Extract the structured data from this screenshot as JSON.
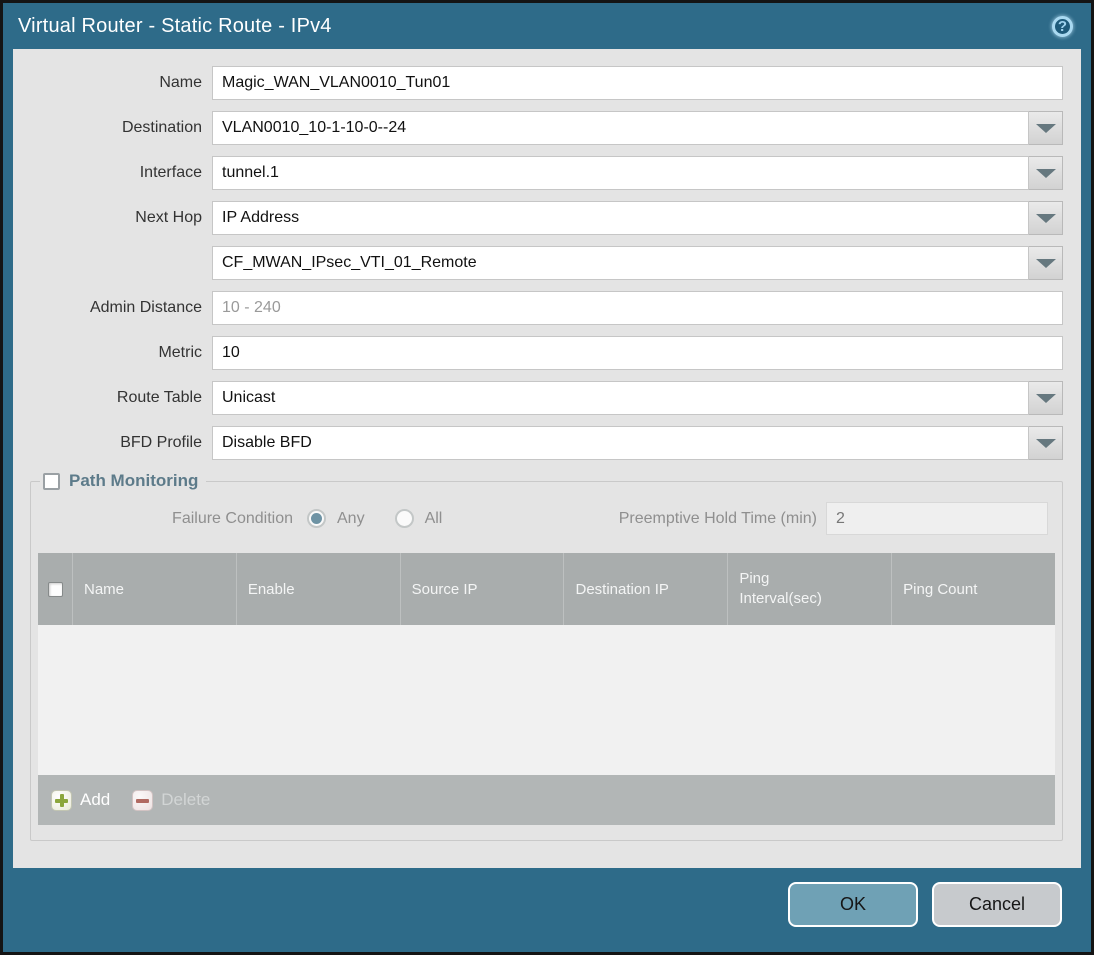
{
  "title": "Virtual Router - Static Route - IPv4",
  "icons": {
    "help_glyph": "?"
  },
  "colors": {
    "chrome_teal": "#2e6b89",
    "panel_gray": "#e4e4e4",
    "accent_legend": "#5d7b8a",
    "table_header_gray": "#a9adad",
    "ok_button": "#6fa1b5",
    "cancel_button": "#c7cacd",
    "add_icon_green": "#8ba63c",
    "delete_icon_red": "#b16a62"
  },
  "form": {
    "name": {
      "label": "Name",
      "value": "Magic_WAN_VLAN0010_Tun01"
    },
    "destination": {
      "label": "Destination",
      "value": "VLAN0010_10-1-10-0--24"
    },
    "interface": {
      "label": "Interface",
      "value": "tunnel.1"
    },
    "next_hop": {
      "label": "Next Hop",
      "value": "IP Address"
    },
    "next_hop_address": {
      "value": "CF_MWAN_IPsec_VTI_01_Remote"
    },
    "admin_distance": {
      "label": "Admin Distance",
      "value": "",
      "placeholder": "10 - 240"
    },
    "metric": {
      "label": "Metric",
      "value": "10"
    },
    "route_table": {
      "label": "Route Table",
      "value": "Unicast"
    },
    "bfd_profile": {
      "label": "BFD Profile",
      "value": "Disable BFD"
    }
  },
  "path_monitoring": {
    "legend": "Path Monitoring",
    "checked": false,
    "failure_condition": {
      "label": "Failure Condition",
      "options": [
        {
          "label": "Any",
          "selected": true
        },
        {
          "label": "All",
          "selected": false
        }
      ]
    },
    "preemptive_hold_time": {
      "label": "Preemptive Hold Time (min)",
      "value": "2"
    },
    "table": {
      "columns": [
        "Name",
        "Enable",
        "Source IP",
        "Destination IP",
        "Ping Interval(sec)",
        "Ping Count"
      ],
      "rows": []
    },
    "add_label": "Add",
    "delete_label": "Delete"
  },
  "footer": {
    "ok_label": "OK",
    "cancel_label": "Cancel"
  }
}
